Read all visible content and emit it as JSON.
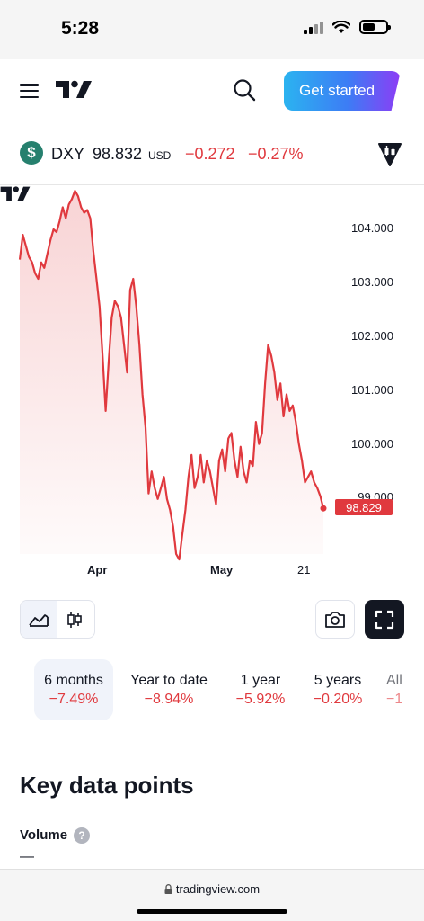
{
  "status": {
    "time": "5:28"
  },
  "nav": {
    "cta_label": "Get started"
  },
  "ticker": {
    "symbol_glyph": "$",
    "symbol": "DXY",
    "price": "98.832",
    "currency": "USD",
    "change": "−0.272",
    "change_pct": "−0.27%",
    "down_color": "#e0393e",
    "icon_bg": "#26806e"
  },
  "chart_data": {
    "type": "area",
    "x_labels": [
      "Apr",
      "May",
      "21"
    ],
    "y_ticks": [
      "104.000",
      "103.000",
      "102.000",
      "101.000",
      "100.000",
      "99.000"
    ],
    "ylim": [
      98.0,
      104.7
    ],
    "last_value_label": "98.829",
    "series": [
      {
        "color": "#e0393e",
        "values": [
          103.35,
          103.8,
          103.6,
          103.4,
          103.3,
          103.1,
          103.0,
          103.3,
          103.2,
          103.45,
          103.7,
          103.9,
          103.85,
          104.05,
          104.3,
          104.1,
          104.35,
          104.45,
          104.6,
          104.5,
          104.3,
          104.2,
          104.25,
          104.1,
          103.5,
          103.0,
          102.5,
          101.6,
          100.6,
          101.5,
          102.3,
          102.6,
          102.5,
          102.3,
          101.8,
          101.3,
          102.8,
          103.0,
          102.5,
          101.8,
          100.9,
          100.3,
          99.1,
          99.5,
          99.2,
          99.0,
          99.2,
          99.4,
          99.0,
          98.8,
          98.5,
          98.0,
          97.9,
          98.35,
          98.8,
          99.4,
          99.8,
          99.2,
          99.4,
          99.8,
          99.3,
          99.7,
          99.5,
          99.2,
          98.9,
          99.7,
          99.9,
          99.5,
          100.1,
          100.2,
          99.7,
          99.4,
          99.95,
          99.5,
          99.3,
          99.7,
          99.6,
          100.4,
          100.0,
          100.2,
          101.1,
          101.8,
          101.6,
          101.3,
          100.8,
          101.1,
          100.5,
          100.9,
          100.6,
          100.7,
          100.4,
          100.0,
          99.7,
          99.3,
          99.4,
          99.5,
          99.3,
          99.2,
          99.05,
          98.83
        ]
      }
    ]
  },
  "controls": {
    "selected_period": 0
  },
  "periods": [
    {
      "label": "6 months",
      "change": "−7.49%"
    },
    {
      "label": "Year to date",
      "change": "−8.94%"
    },
    {
      "label": "1 year",
      "change": "−5.92%"
    },
    {
      "label": "5 years",
      "change": "−0.20%"
    },
    {
      "label": "All",
      "change": "−1"
    }
  ],
  "key_data": {
    "title": "Key data points",
    "volume_label": "Volume",
    "volume_value": "—",
    "help_glyph": "?"
  },
  "browser": {
    "url": "tradingview.com"
  }
}
